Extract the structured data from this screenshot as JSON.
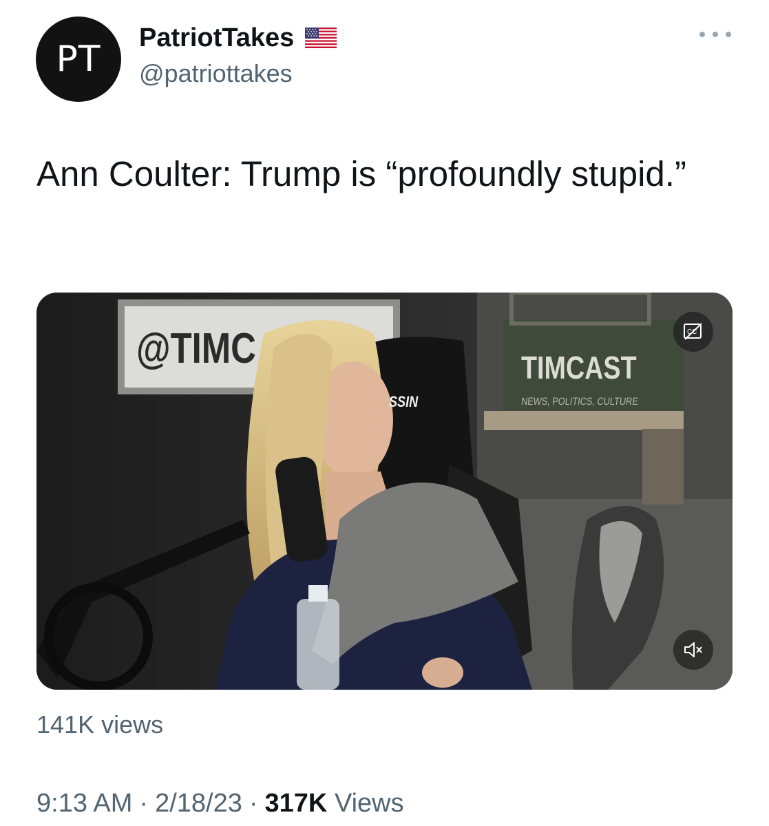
{
  "author": {
    "avatar_text": "PT",
    "display_name": "PatriotTakes",
    "handle": "@patriottakes",
    "badge_icon": "us-flag-icon"
  },
  "tweet": {
    "text": "Ann Coulter: Trump is “profoundly stupid.”"
  },
  "media": {
    "type": "video",
    "scene_sign_text": "@TIMC",
    "scene_box_text": "TIMCAST",
    "scene_box_subtext": "NEWS, POLITICS, CULTURE",
    "scene_chair_text": "SSIN",
    "cc_icon": "closed-captions-icon",
    "mute_icon": "volume-muted-icon",
    "views_label": "141K views"
  },
  "meta": {
    "time": "9:13 AM",
    "separator": "·",
    "date": "2/18/23",
    "views_count": "317K",
    "views_label": "Views"
  },
  "colors": {
    "text_primary": "#0f1419",
    "text_secondary": "#536471",
    "avatar_bg": "#121212"
  }
}
